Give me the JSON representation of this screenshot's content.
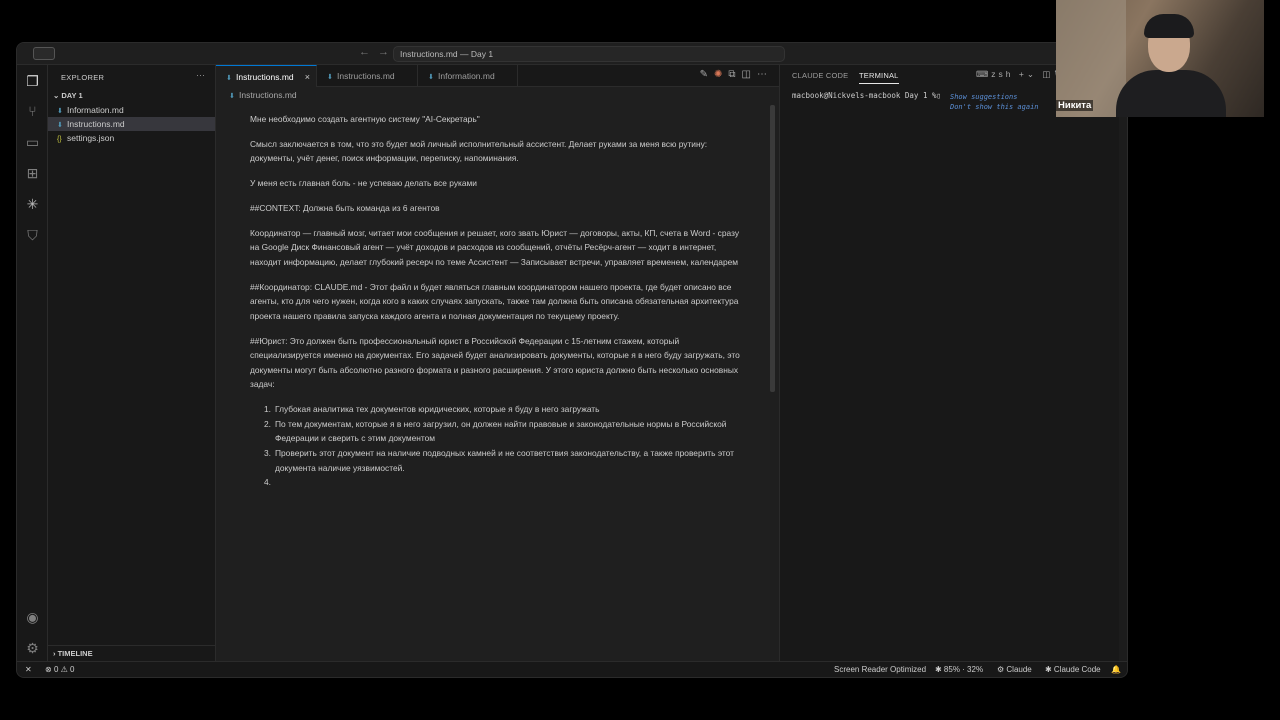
{
  "titlebar": {
    "search_text": "Instructions.md — Day 1",
    "nav_back": "←",
    "nav_forward": "→"
  },
  "activity": {
    "icons": [
      "files-icon",
      "source-control-icon",
      "remote-explorer-icon",
      "extensions-icon",
      "claude-icon",
      "shield-icon",
      "account-icon",
      "settings-gear-icon"
    ]
  },
  "sidebar": {
    "title": "EXPLORER",
    "more": "···",
    "folder": "DAY 1",
    "files": [
      {
        "name": "Information.md",
        "type": "md"
      },
      {
        "name": "Instructions.md",
        "type": "md"
      },
      {
        "name": "settings.json",
        "type": "json"
      }
    ],
    "timeline": "TIMELINE"
  },
  "editor": {
    "tabs": [
      {
        "label": "Instructions.md"
      },
      {
        "label": "Instructions.md"
      },
      {
        "label": "Information.md"
      }
    ],
    "close": "×",
    "breadcrumb": "Instructions.md",
    "paragraphs": [
      "Мне необходимо создать агентную систему \"AI-Секретарь\"",
      "Смысл заключается в том, что это будет мой личный исполнительный ассистент. Делает руками за меня всю рутину: документы, учёт денег, поиск информации, переписку, напоминания.",
      "У меня есть главная боль - не успеваю делать все руками",
      "##CONTEXT: Должна быть команда из 6 агентов",
      "Координатор — главный мозг, читает мои сообщения и решает, кого звать Юрист — договоры, акты, КП, счета в Word - сразу на Google Диск Финансовый агент — учёт доходов и расходов из сообщений, отчёты Ресёрч-агент — ходит в интернет, находит информацию, делает глубокий ресерч по теме Ассистент — Записывает встречи, управляет временем, календарем",
      "##Координатор: CLAUDE.md - Этот файл и будет являться главным координатором нашего проекта, где будет описано все агенты, кто для чего нужен, когда кого в каких случаях запускать, также там должна быть описана обязательная архитектура проекта нашего правила запуска каждого агента и полная документация по текущему проекту.",
      "##Юрист: Это должен быть профессиональный юрист в Российской Федерации с 15-летним стажем, который специализируется именно на документах. Его задачей будет анализировать документы, которые я в него буду загружать, это документы могут быть абсолютно разного формата и разного расширения. У этого юриста должно быть несколько основных задач:"
    ],
    "list": [
      {
        "num": "1.",
        "text": "Глубокая аналитика тех документов юридических, которые я буду в него загружать"
      },
      {
        "num": "2.",
        "text": "По тем документам, которые я в него загрузил, он должен найти правовые и законодательные нормы в Российской Федерации и сверить с этим документом"
      },
      {
        "num": "3.",
        "text": "Проверить этот документ на наличие подводных камней и не соответствия законодательству, а также проверить этот документа наличие уязвимостей."
      },
      {
        "num": "4.",
        "text": ""
      }
    ]
  },
  "panel": {
    "tabs": [
      "CLAUDE CODE",
      "TERMINAL"
    ],
    "shell": "zsh",
    "prompt": "macbook@Nickvels-macbook Day 1 %",
    "hint_1": "Show suggestions",
    "hint_2": "Don't show this again"
  },
  "status": {
    "errors": "0",
    "warnings": "0",
    "screen_reader": "Screen Reader Optimized",
    "usage": "✱ 85% · 32%",
    "claude": "Claude",
    "claude_code": "✱ Claude Code"
  },
  "webcam": {
    "name": "Никита"
  },
  "colors": {
    "accent": "#0078d4",
    "editor_bg": "#1f1f1f",
    "sidebar_bg": "#181818",
    "selected": "#37373d",
    "claude": "#d97757"
  }
}
